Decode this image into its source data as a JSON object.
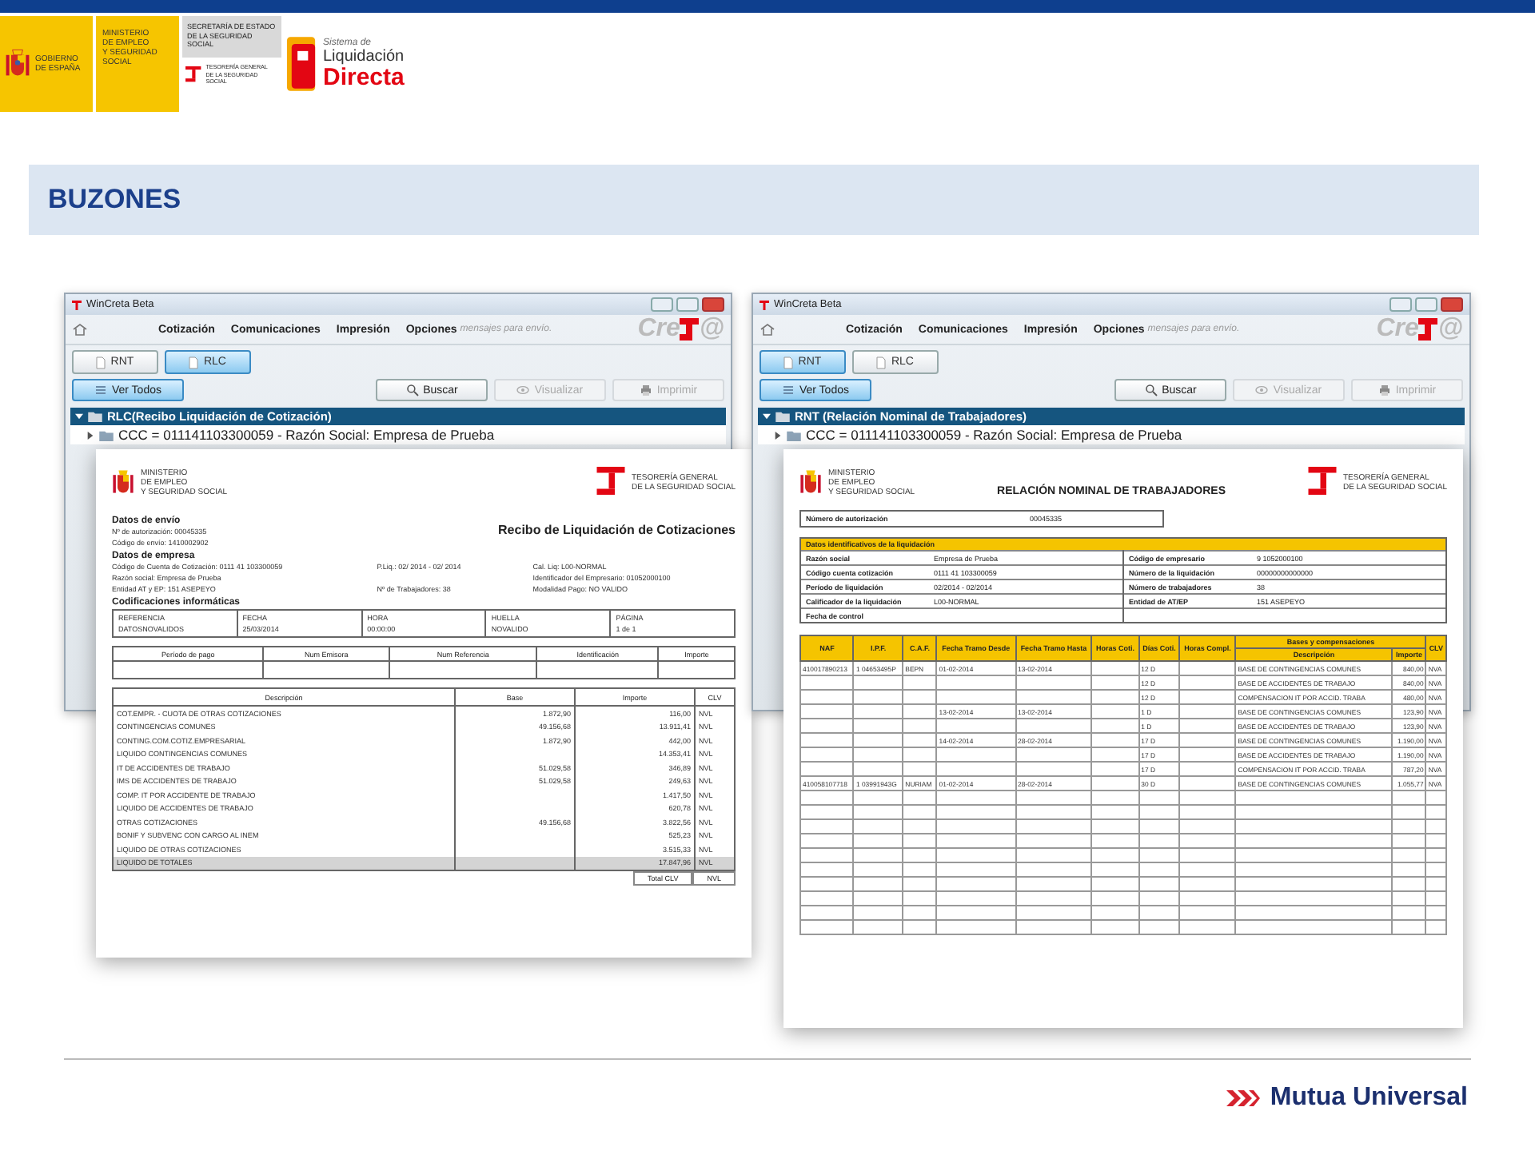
{
  "header": {
    "government": [
      "GOBIERNO",
      "DE ESPAÑA"
    ],
    "ministry": [
      "MINISTERIO",
      "DE EMPLEO",
      "Y SEGURIDAD SOCIAL"
    ],
    "secretary": [
      "SECRETARÍA DE ESTADO",
      "DE LA SEGURIDAD SOCIAL"
    ],
    "treasury": [
      "TESORERÍA GENERAL",
      "DE LA SEGURIDAD SOCIAL"
    ],
    "system": [
      "Sistema de",
      "Liquidación",
      "Directa"
    ]
  },
  "section_title": "BUZONES",
  "panels": [
    {
      "window": {
        "title": "WinCreta Beta",
        "menu": [
          "Cotización",
          "Comunicaciones",
          "Impresión",
          "Opciones"
        ],
        "message": "mensajes para envío.",
        "brand": "Cre",
        "brand_suffix": "@",
        "tabs": [
          {
            "label": "RNT",
            "selected": false
          },
          {
            "label": "RLC",
            "selected": true
          }
        ],
        "actions": [
          {
            "label": "Ver Todos",
            "kind": "filter",
            "disabled": false
          },
          {
            "label": "Buscar",
            "kind": "search",
            "disabled": false
          },
          {
            "label": "Visualizar",
            "kind": "view",
            "disabled": true
          },
          {
            "label": "Imprimir",
            "kind": "print",
            "disabled": true
          }
        ],
        "tree": {
          "label": "RLC(Recibo Liquidación de Cotización)",
          "expanded": true,
          "children": [
            {
              "label": "CCC = 011141103300059 - Razón Social: Empresa de Prueba",
              "expanded": false
            }
          ]
        }
      },
      "document": {
        "kind": "rlc",
        "ministry": [
          "MINISTERIO",
          "DE EMPLEO",
          "Y SEGURIDAD SOCIAL"
        ],
        "treasury": [
          "TESORERÍA GENERAL",
          "DE LA SEGURIDAD SOCIAL"
        ],
        "title": "Recibo de Liquidación de Cotizaciones",
        "send": {
          "heading": "Datos de envío",
          "lines": [
            "Nº de autorización: 00045335",
            "Código de envío: 1410002902"
          ]
        },
        "company": {
          "heading": "Datos de empresa",
          "rows": [
            [
              "Código de Cuenta de Cotización: 0111  41  103300059",
              "P.Liq.: 02/ 2014 - 02/ 2014",
              "Cal. Liq: L00-NORMAL"
            ],
            [
              "Razón social: Empresa de Prueba",
              null,
              "Identificador del Empresario: 01052000100"
            ],
            [
              "Entidad AT y EP: 151 ASEPEYO",
              "Nº de Trabajadores: 38",
              "Modalidad Pago: NO VALIDO"
            ]
          ]
        },
        "codes": {
          "heading": "Codificaciones informáticas",
          "fields": [
            {
              "label": "REFERENCIA",
              "value": "DATOSNOVALIDOS"
            },
            {
              "label": "FECHA",
              "value": "25/03/2014"
            },
            {
              "label": "HORA",
              "value": "00:00:00"
            },
            {
              "label": "HUELLA",
              "value": "NOVALIDO"
            },
            {
              "label": "PÁGINA",
              "value": "1 de 1"
            }
          ]
        },
        "payment": {
          "columns": [
            "Período de pago",
            "Num Emisora",
            "Num Referencia",
            "Identificación",
            "Importe"
          ]
        },
        "detail": {
          "columns": [
            "Descripción",
            "Base",
            "Importe",
            "CLV"
          ],
          "rows": [
            {
              "description": "COT.EMPR. - CUOTA DE OTRAS COTIZACIONES",
              "base": "1.872,90",
              "amount": "116,00",
              "clv": "NVL",
              "total": false
            },
            {
              "description": "CONTINGENCIAS COMUNES",
              "base": "49.156,68",
              "amount": "13.911,41",
              "clv": "NVL",
              "total": false
            },
            {
              "description": "CONTING.COM.COTIZ.EMPRESARIAL",
              "base": "1.872,90",
              "amount": "442,00",
              "clv": "NVL",
              "total": false
            },
            {
              "description": "LIQUIDO CONTINGENCIAS COMUNES",
              "base": null,
              "amount": "14.353,41",
              "clv": "NVL",
              "total": false
            },
            {
              "description": "IT DE ACCIDENTES DE TRABAJO",
              "base": "51.029,58",
              "amount": "346,89",
              "clv": "NVL",
              "total": false
            },
            {
              "description": "IMS DE ACCIDENTES DE TRABAJO",
              "base": "51.029,58",
              "amount": "249,63",
              "clv": "NVL",
              "total": false
            },
            {
              "description": "COMP. IT POR ACCIDENTE DE TRABAJO",
              "base": null,
              "amount": "1.417,50",
              "clv": "NVL",
              "total": false
            },
            {
              "description": "LIQUIDO DE ACCIDENTES DE TRABAJO",
              "base": null,
              "amount": "620,78",
              "clv": "NVL",
              "total": false
            },
            {
              "description": "OTRAS COTIZACIONES",
              "base": "49.156,68",
              "amount": "3.822,56",
              "clv": "NVL",
              "total": false
            },
            {
              "description": "BONIF Y SUBVENC CON CARGO AL INEM",
              "base": null,
              "amount": "525,23",
              "clv": "NVL",
              "total": false
            },
            {
              "description": "LIQUIDO DE OTRAS COTIZACIONES",
              "base": null,
              "amount": "3.515,33",
              "clv": "NVL",
              "total": false
            },
            {
              "description": "LIQUIDO DE TOTALES",
              "base": null,
              "amount": "17.847,96",
              "clv": "NVL",
              "total": true
            }
          ],
          "total": {
            "label": "Total CLV",
            "value": "NVL"
          }
        }
      }
    },
    {
      "window": {
        "title": "WinCreta Beta",
        "menu": [
          "Cotización",
          "Comunicaciones",
          "Impresión",
          "Opciones"
        ],
        "message": "mensajes para envío.",
        "brand": "Cre",
        "brand_suffix": "@",
        "tabs": [
          {
            "label": "RNT",
            "selected": true
          },
          {
            "label": "RLC",
            "selected": false
          }
        ],
        "actions": [
          {
            "label": "Ver Todos",
            "kind": "filter",
            "disabled": false
          },
          {
            "label": "Buscar",
            "kind": "search",
            "disabled": false
          },
          {
            "label": "Visualizar",
            "kind": "view",
            "disabled": true
          },
          {
            "label": "Imprimir",
            "kind": "print",
            "disabled": true
          }
        ],
        "tree": {
          "label": "RNT (Relación Nominal de Trabajadores)",
          "expanded": true,
          "children": [
            {
              "label": "CCC = 011141103300059 - Razón Social: Empresa de Prueba",
              "expanded": false
            }
          ]
        }
      },
      "document": {
        "kind": "rnt",
        "ministry": [
          "MINISTERIO",
          "DE EMPLEO",
          "Y SEGURIDAD SOCIAL"
        ],
        "treasury": [
          "TESORERÍA GENERAL",
          "DE LA SEGURIDAD SOCIAL"
        ],
        "title": "RELACIÓN NOMINAL DE TRABAJADORES",
        "authorization": {
          "label": "Número de autorización",
          "value": "00045335"
        },
        "identification": {
          "heading": "Datos identificativos de la liquidación",
          "left": [
            {
              "label": "Razón social",
              "value": "Empresa de Prueba"
            },
            {
              "label": "Código cuenta cotización",
              "value": "0111   41   103300059"
            },
            {
              "label": "Período de liquidación",
              "value": "02/2014 - 02/2014"
            },
            {
              "label": "Calificador de la liquidación",
              "value": "L00-NORMAL"
            },
            {
              "label": "Fecha de control"
            }
          ],
          "right": [
            {
              "label": "Código de empresario",
              "value": "9   1052000100"
            },
            {
              "label": "Número de la liquidación",
              "value": "00000000000000"
            },
            {
              "label": "Número de trabajadores",
              "value": "38"
            },
            {
              "label": "Entidad de AT/EP",
              "value": "151 ASEPEYO"
            }
          ]
        },
        "table": {
          "columns": [
            "NAF",
            "I.P.F.",
            "C.A.F.",
            "Fecha Tramo Desde",
            "Fecha Tramo Hasta",
            "Horas Coti.",
            "Días Coti.",
            "Horas Compl."
          ],
          "group": "Bases y compensaciones",
          "subcolumns": [
            "Descripción",
            "Importe"
          ],
          "last": "CLV",
          "rows": [
            {
              "cells": [
                "410017890213",
                "1 04653495P",
                "BEPN",
                "01-02-2014",
                "13-02-2014",
                null,
                "12 D",
                null
              ],
              "description": "BASE DE CONTINGENCIAS COMUNES",
              "amount": "840,00",
              "clv": "NVA"
            },
            {
              "cells": [
                null,
                null,
                null,
                null,
                null,
                null,
                "12 D",
                null
              ],
              "description": "BASE DE ACCIDENTES DE TRABAJO",
              "amount": "840,00",
              "clv": "NVA"
            },
            {
              "cells": [
                null,
                null,
                null,
                null,
                null,
                null,
                "12 D",
                null
              ],
              "description": "COMPENSACION IT POR ACCID. TRABA",
              "amount": "480,00",
              "clv": "NVA"
            },
            {
              "cells": [
                null,
                null,
                null,
                "13-02-2014",
                "13-02-2014",
                null,
                "1 D",
                null
              ],
              "description": "BASE DE CONTINGENCIAS COMUNES",
              "amount": "123,90",
              "clv": "NVA"
            },
            {
              "cells": [
                null,
                null,
                null,
                null,
                null,
                null,
                "1 D",
                null
              ],
              "description": "BASE DE ACCIDENTES DE TRABAJO",
              "amount": "123,90",
              "clv": "NVA"
            },
            {
              "cells": [
                null,
                null,
                null,
                "14-02-2014",
                "28-02-2014",
                null,
                "17 D",
                null
              ],
              "description": "BASE DE CONTINGENCIAS COMUNES",
              "amount": "1.190,00",
              "clv": "NVA"
            },
            {
              "cells": [
                null,
                null,
                null,
                null,
                null,
                null,
                "17 D",
                null
              ],
              "description": "BASE DE ACCIDENTES DE TRABAJO",
              "amount": "1.190,00",
              "clv": "NVA"
            },
            {
              "cells": [
                null,
                null,
                null,
                null,
                null,
                null,
                "17 D",
                null
              ],
              "description": "COMPENSACION IT POR ACCID. TRABA",
              "amount": "787,20",
              "clv": "NVA"
            },
            {
              "cells": [
                "410058107718",
                "1 03991943G",
                "NURIAM",
                "01-02-2014",
                "28-02-2014",
                null,
                "30 D",
                null
              ],
              "description": "BASE DE CONTINGENCIAS COMUNES",
              "amount": "1.055,77",
              "clv": "NVA"
            }
          ]
        }
      }
    }
  ],
  "footer": {
    "brand": "Mutua Universal"
  }
}
